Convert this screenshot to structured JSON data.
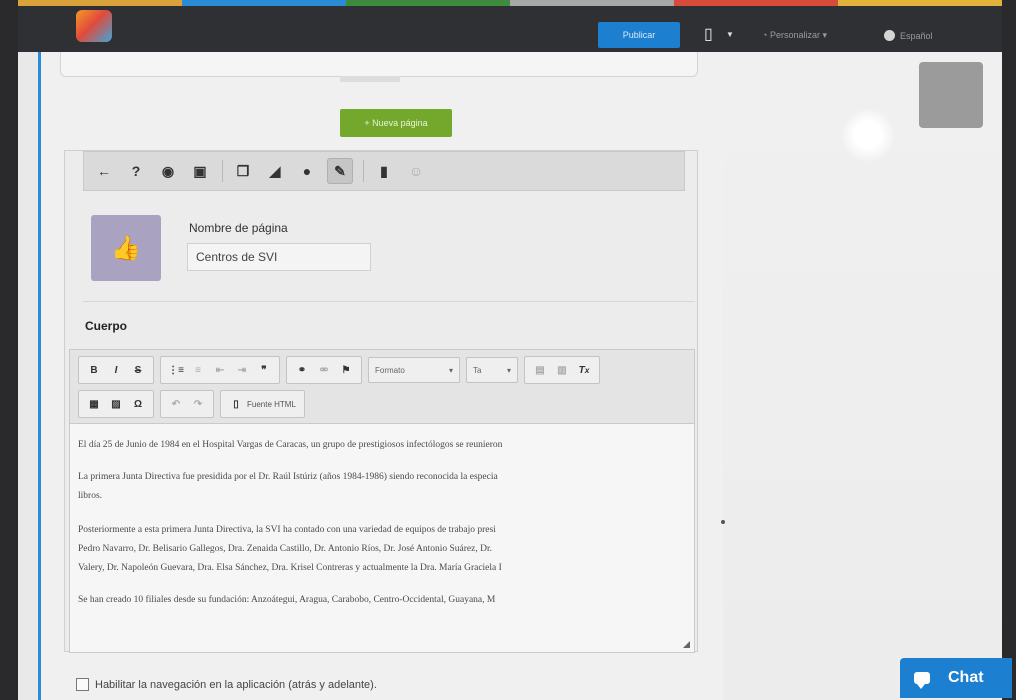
{
  "topbar": {
    "stripe_colors": [
      "#d9a23a",
      "#2a8bd6",
      "#3d8b3d",
      "#a8a8a8",
      "#d84a3a",
      "#e0b23a"
    ],
    "publish_label": "Publicar",
    "device_icon": "tablet-icon",
    "personalize_label": "Personalizar",
    "language_label": "Español"
  },
  "new_page_button": "+ Nueva página",
  "page_toolbar": {
    "icons": [
      "back-arrow-icon",
      "help-icon",
      "preview-eye-icon",
      "lock-icon",
      "pages-icon",
      "stats-icon",
      "comments-icon",
      "edit-icon",
      "delete-icon",
      "emoji-icon"
    ]
  },
  "page_form": {
    "name_label": "Nombre de página",
    "name_value": "Centros de SVI",
    "body_label": "Cuerpo"
  },
  "editor": {
    "format_label": "Formato",
    "size_label": "Ta",
    "source_button": "Fuente HTML",
    "paragraphs": [
      "El día 25 de Junio de 1984 en el Hospital Vargas de Caracas, un grupo de prestigiosos infectólogos se reunieron",
      "La primera Junta Directiva fue presidida por el Dr. Raúl Istúriz (años 1984-1986) siendo reconocida la especia",
      "libros.",
      "Posteriormente a esta primera Junta Directiva, la SVI ha contado con una variedad de equipos de trabajo presi",
      "Pedro Navarro, Dr. Belisario Gallegos, Dra. Zenaida Castillo, Dr. Antonio Ríos, Dr. José Antonio Suárez, Dr.",
      "Valery, Dr. Napoleón Guevara, Dra. Elsa Sánchez, Dra. Krisel Contreras y actualmente la Dra. María Graciela I",
      "Se han creado 10 filiales desde su fundación: Anzoátegui, Aragua, Carabobo, Centro-Occidental, Guayana, M"
    ]
  },
  "navigation_checkbox_label": "Habilitar la navegación en la aplicación (atrás y adelante).",
  "chat_label": "Chat",
  "colors": {
    "accent_blue": "#2a8bd6",
    "new_page_green": "#74a82d",
    "chat_blue": "#1c7fd0"
  }
}
